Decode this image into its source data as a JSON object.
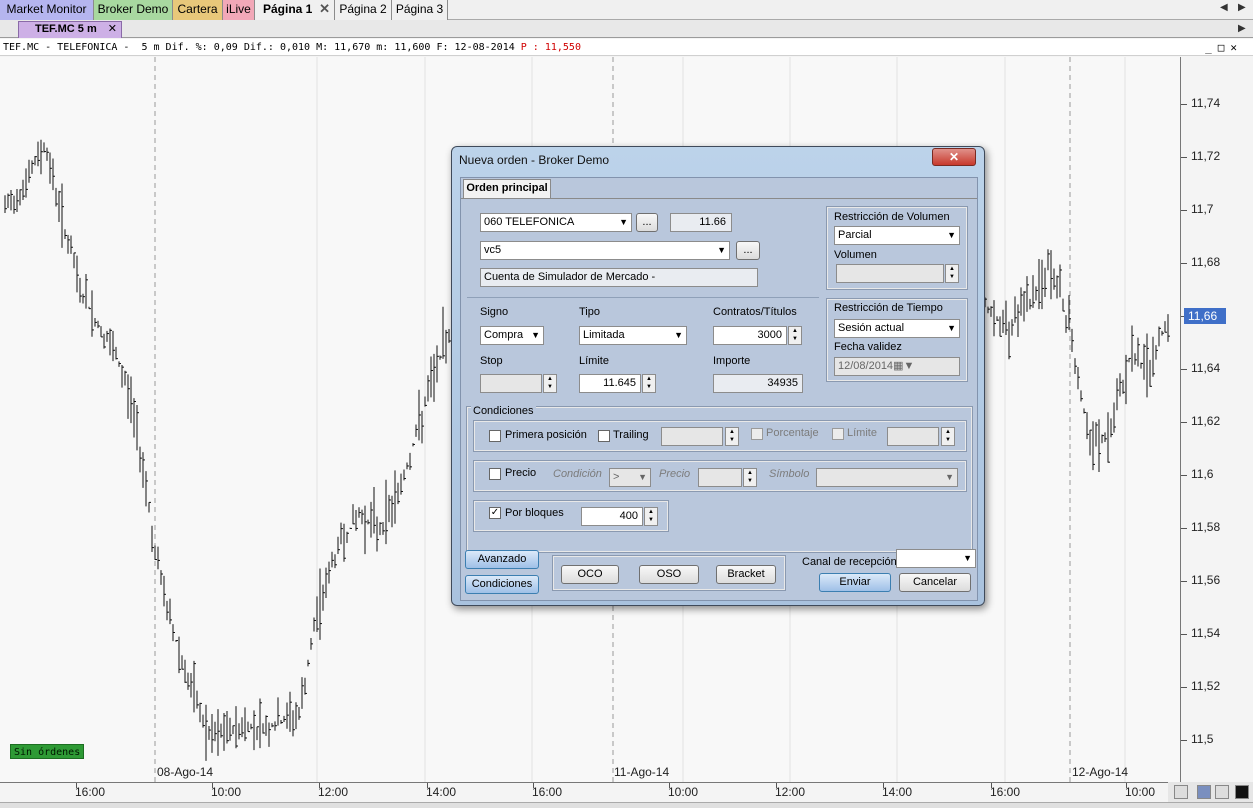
{
  "top_tabs": [
    {
      "label": "Market Monitor",
      "color": "#b5b5ef"
    },
    {
      "label": "Broker Demo",
      "color": "#a8d8a0"
    },
    {
      "label": "Cartera",
      "color": "#e8c87a"
    },
    {
      "label": "iLive",
      "color": "#f2a8b8"
    },
    {
      "label": "Página 1",
      "color": "#f0f0f0"
    },
    {
      "label": "Página 2",
      "color": "#f0f0f0"
    },
    {
      "label": "Página 3",
      "color": "#f0f0f0"
    }
  ],
  "chart_tab": {
    "label": "TEF.MC 5 m",
    "close": "✕"
  },
  "info_bar": {
    "text": "TEF.MC - TELEFONICA -  5 m Dif. %: 0,09 Dif.: 0,010 M: 11,670 m: 11,600 F: 12-08-2014 ",
    "price_text": "P : 11,550"
  },
  "chart_data": {
    "type": "bar",
    "y_ticks": [
      "11,74",
      "11,72",
      "11,7",
      "11,68",
      "11,66",
      "11,64",
      "11,62",
      "11,6",
      "11,58",
      "11,56",
      "11,54",
      "11,52",
      "11,5"
    ],
    "ylim": [
      11.5,
      11.74
    ],
    "last_price": "11,66",
    "x_ticks": [
      "16:00",
      "10:00",
      "12:00",
      "14:00",
      "16:00",
      "10:00",
      "12:00",
      "14:00",
      "16:00",
      "10:00"
    ],
    "date_markers": [
      "08-Ago-14",
      "11-Ago-14",
      "12-Ago-14"
    ]
  },
  "status": {
    "no_orders": "Sin órdenes"
  },
  "dialog": {
    "title": "Nueva orden - Broker Demo",
    "close": "✕",
    "tab": "Orden principal",
    "instrument": "060 TELEFONICA",
    "instrument_btn": "...",
    "price_display": "11.66",
    "account": "vc5",
    "account_btn": "...",
    "account_desc": "Cuenta de Simulador de Mercado -",
    "volume_restriction": {
      "title": "Restricción de Volumen",
      "value": "Parcial",
      "volume_label": "Volumen",
      "volume_value": ""
    },
    "time_restriction": {
      "title": "Restricción de Tiempo",
      "value": "Sesión actual",
      "date_label": "Fecha validez",
      "date_value": "12/08/2014"
    },
    "signo": {
      "label": "Signo",
      "value": "Compra"
    },
    "tipo": {
      "label": "Tipo",
      "value": "Limitada"
    },
    "contratos": {
      "label": "Contratos/Títulos",
      "value": "3000"
    },
    "stop": {
      "label": "Stop",
      "value": ""
    },
    "limite": {
      "label": "Límite",
      "value": "11.645"
    },
    "importe": {
      "label": "Importe",
      "value": "34935"
    },
    "conditions": {
      "title": "Condiciones",
      "primera": "Primera posición",
      "trailing": "Trailing",
      "porcentaje": "Porcentaje",
      "limite": "Límite",
      "precio": "Precio",
      "condicion": "Condición",
      "condicion_value": ">",
      "precio_lbl": "Precio",
      "simbolo": "Símbolo",
      "por_bloques": "Por bloques",
      "bloques_value": "400"
    },
    "buttons": {
      "avanzado": "Avanzado",
      "condiciones": "Condiciones",
      "oco": "OCO",
      "oso": "OSO",
      "bracket": "Bracket",
      "canal": "Canal de recepción",
      "enviar": "Enviar",
      "cancelar": "Cancelar"
    }
  }
}
